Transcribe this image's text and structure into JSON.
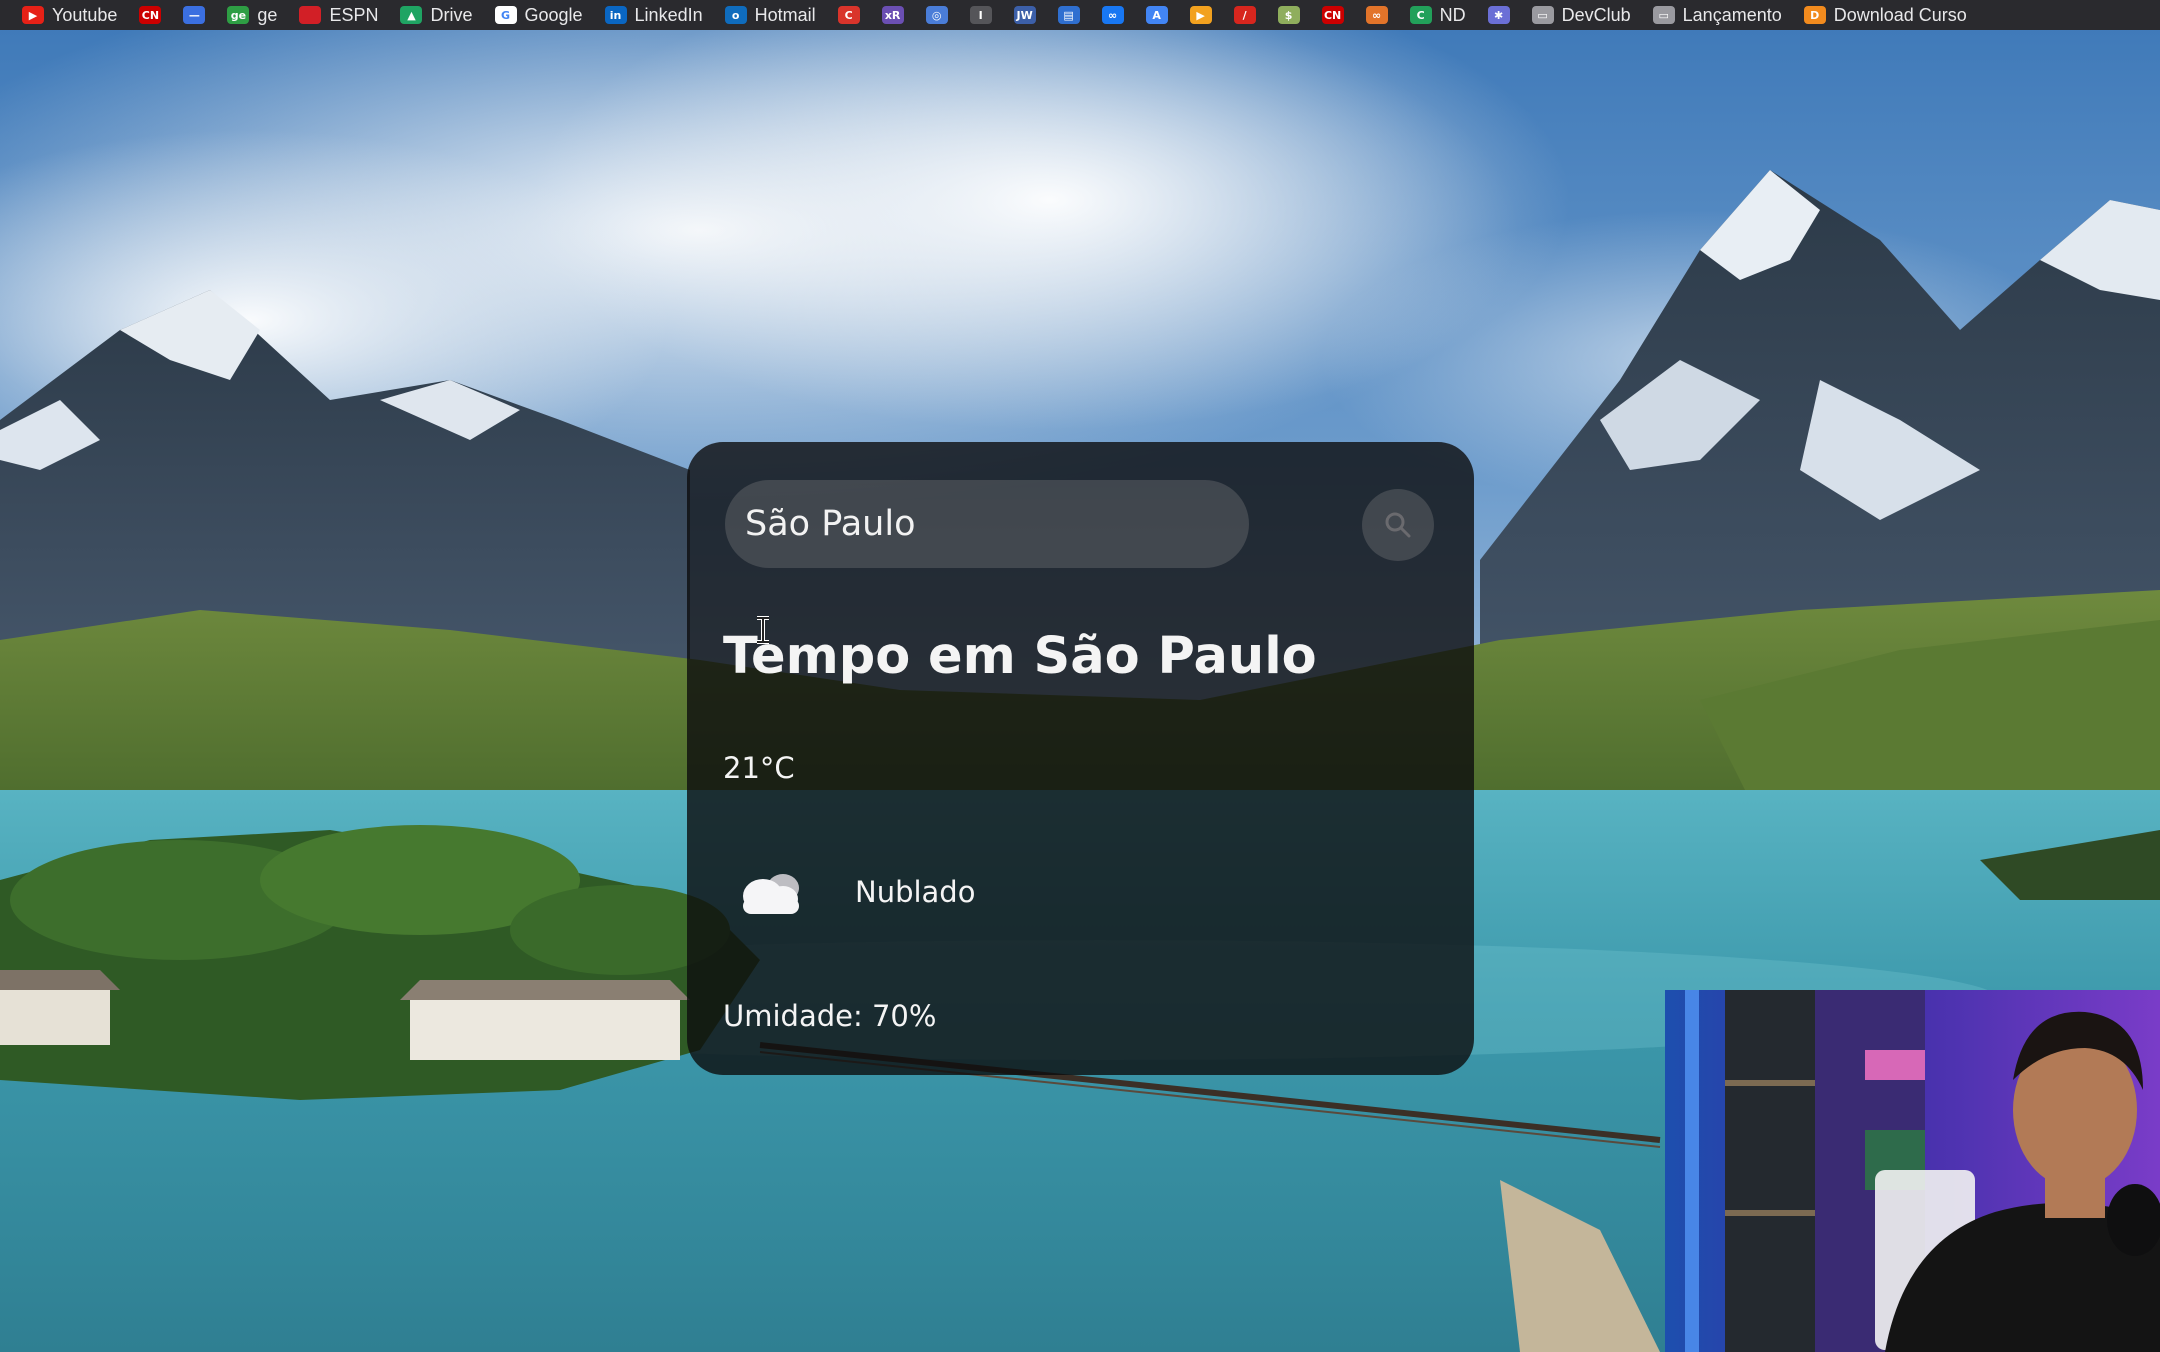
{
  "bookmarks": [
    {
      "icon": "youtube-icon",
      "label": "Youtube",
      "color": "#e62117",
      "glyph": "▶"
    },
    {
      "icon": "cnn-icon",
      "label": "",
      "color": "#cc0000",
      "glyph": "CN"
    },
    {
      "icon": "bookmark-icon",
      "label": "",
      "color": "#3b6fe0",
      "glyph": "—"
    },
    {
      "icon": "ge-icon",
      "label": "ge",
      "color": "#2e9e44",
      "glyph": "ge"
    },
    {
      "icon": "espn-icon",
      "label": "ESPN",
      "color": "#d21f26",
      "glyph": ""
    },
    {
      "icon": "google-drive-icon",
      "label": "Drive",
      "color": "#1fa463",
      "glyph": "▲"
    },
    {
      "icon": "google-icon",
      "label": "Google",
      "color": "#ffffff",
      "glyph": "G"
    },
    {
      "icon": "linkedin-icon",
      "label": "LinkedIn",
      "color": "#0a66c2",
      "glyph": "in"
    },
    {
      "icon": "outlook-icon",
      "label": "Hotmail",
      "color": "#0f6cbd",
      "glyph": "o"
    },
    {
      "icon": "c-icon",
      "label": "",
      "color": "#d9342b",
      "glyph": "C"
    },
    {
      "icon": "xr-icon",
      "label": "",
      "color": "#6b4fb3",
      "glyph": "xR"
    },
    {
      "icon": "circle-icon",
      "label": "",
      "color": "#4a7dd8",
      "glyph": "◎"
    },
    {
      "icon": "italic-icon",
      "label": "",
      "color": "#555559",
      "glyph": "I"
    },
    {
      "icon": "jw-icon",
      "label": "",
      "color": "#3c5fa8",
      "glyph": "JW"
    },
    {
      "icon": "page-icon",
      "label": "",
      "color": "#2f6fd0",
      "glyph": "▤"
    },
    {
      "icon": "meta-icon",
      "label": "",
      "color": "#1877f2",
      "glyph": "∞"
    },
    {
      "icon": "ads-icon",
      "label": "",
      "color": "#4285f4",
      "glyph": "A"
    },
    {
      "icon": "play-icon",
      "label": "",
      "color": "#f2a11f",
      "glyph": "▶"
    },
    {
      "icon": "pdf-icon",
      "label": "",
      "color": "#d7261e",
      "glyph": "/"
    },
    {
      "icon": "money-icon",
      "label": "",
      "color": "#8fae5d",
      "glyph": "$"
    },
    {
      "icon": "cnn2-icon",
      "label": "",
      "color": "#cc0000",
      "glyph": "CN"
    },
    {
      "icon": "link-icon",
      "label": "",
      "color": "#e2742a",
      "glyph": "∞"
    },
    {
      "icon": "nd-icon",
      "label": "ND",
      "color": "#22a05a",
      "glyph": "C"
    },
    {
      "icon": "star-icon",
      "label": "",
      "color": "#6b6fd6",
      "glyph": "✱"
    },
    {
      "icon": "folder-icon",
      "label": "DevClub",
      "color": "#9a9aa0",
      "glyph": "▭"
    },
    {
      "icon": "folder-icon",
      "label": "Lançamento",
      "color": "#9a9aa0",
      "glyph": "▭"
    },
    {
      "icon": "download-icon",
      "label": "Download Curso",
      "color": "#f28b1e",
      "glyph": "D"
    }
  ],
  "search": {
    "value": "São Paulo",
    "placeholder": "São Paulo",
    "button_icon": "search-icon"
  },
  "weather": {
    "title": "Tempo em São Paulo",
    "temperature": "21°C",
    "icon": "cloud-icon",
    "description": "Nublado",
    "humidity": "Umidade: 70%"
  },
  "colors": {
    "card_background": "#0c0c0e",
    "text": "#f4f4f4",
    "bookmark_bar": "#2a2a2e"
  }
}
